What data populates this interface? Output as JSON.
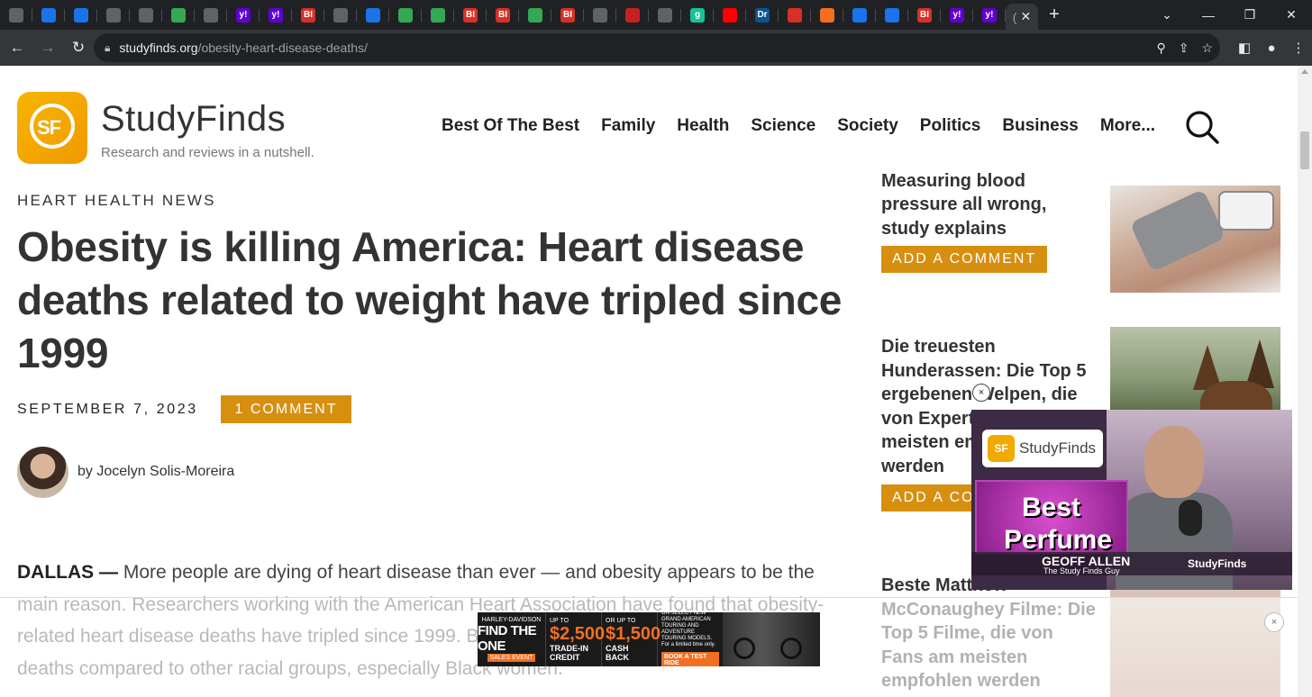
{
  "browser": {
    "tabs": [
      {
        "icon": "globe-icon",
        "label": "",
        "color": "#5f6368"
      },
      {
        "icon": "shield-icon",
        "label": "",
        "color": "#1a73e8"
      },
      {
        "icon": "shield-icon",
        "label": "",
        "color": "#1a73e8"
      },
      {
        "icon": "doc-icon",
        "label": "",
        "color": "#5f6368"
      },
      {
        "icon": "puzzle-icon",
        "label": "",
        "color": "#5f6368"
      },
      {
        "icon": "play-icon",
        "label": "",
        "color": "#34a853"
      },
      {
        "icon": "globe-icon",
        "label": "",
        "color": "#5f6368"
      },
      {
        "icon": "yahoo-icon",
        "label": "y!",
        "color": "#6001d2"
      },
      {
        "icon": "yahoo-icon",
        "label": "y!",
        "color": "#6001d2"
      },
      {
        "icon": "bi-icon",
        "label": "BI",
        "color": "#d93025"
      },
      {
        "icon": "stripe-icon",
        "label": "",
        "color": "#5f6368"
      },
      {
        "icon": "shield-icon",
        "label": "",
        "color": "#1a73e8"
      },
      {
        "icon": "play-icon",
        "label": "",
        "color": "#34a853"
      },
      {
        "icon": "play-icon",
        "label": "",
        "color": "#34a853"
      },
      {
        "icon": "bi-icon",
        "label": "BI",
        "color": "#d93025"
      },
      {
        "icon": "bi-icon",
        "label": "BI",
        "color": "#d93025"
      },
      {
        "icon": "play-icon",
        "label": "",
        "color": "#34a853"
      },
      {
        "icon": "bi-icon",
        "label": "BI",
        "color": "#d93025"
      },
      {
        "icon": "globe-icon",
        "label": "",
        "color": "#5f6368"
      },
      {
        "icon": "burst-icon",
        "label": "",
        "color": "#c5221f"
      },
      {
        "icon": "news-icon",
        "label": "",
        "color": "#5f6368"
      },
      {
        "icon": "g-icon",
        "label": "g",
        "color": "#15c39a"
      },
      {
        "icon": "youtube-icon",
        "label": "",
        "color": "#ff0000"
      },
      {
        "icon": "dr-icon",
        "label": "Dr",
        "color": "#0b5394"
      },
      {
        "icon": "arrow-icon",
        "label": "",
        "color": "#d93025"
      },
      {
        "icon": "stack-icon",
        "label": "",
        "color": "#f26f21"
      },
      {
        "icon": "cube-icon",
        "label": "",
        "color": "#1a73e8"
      },
      {
        "icon": "cube-icon",
        "label": "",
        "color": "#1a73e8"
      },
      {
        "icon": "bi-icon",
        "label": "BI",
        "color": "#d93025"
      },
      {
        "icon": "yahoo-icon",
        "label": "y!",
        "color": "#6001d2"
      },
      {
        "icon": "yahoo-icon",
        "label": "y!",
        "color": "#6001d2"
      }
    ],
    "active_tab_label": "(",
    "url_host": "studyfinds.org",
    "url_path": "/obesity-heart-disease-deaths/"
  },
  "site": {
    "logo_text": "SF",
    "name": "StudyFinds",
    "tagline": "Research and reviews in a nutshell.",
    "accent": "#d68f0f",
    "nav": [
      "Best Of The Best",
      "Family",
      "Health",
      "Science",
      "Society",
      "Politics",
      "Business",
      "More..."
    ]
  },
  "article": {
    "category": "HEART HEALTH NEWS",
    "title": "Obesity is killing America: Heart disease deaths related to weight have tripled since 1999",
    "date": "SEPTEMBER 7, 2023",
    "comments": "1 COMMENT",
    "byline": "by Jocelyn Solis-Moreira",
    "lead": "DALLAS —",
    "body": "More people are dying of heart disease than ever — and obesity appears to be the main reason. Researchers working with the American Heart Association have found that obesity-related heart disease deaths have tripled since 1999. Black Americans make up a majority of deaths compared to other racial groups, especially Black women."
  },
  "sidebar": {
    "items": [
      {
        "title_partial": "Measuring blood",
        "title": "pressure all wrong, study explains",
        "button": "ADD A COMMENT"
      },
      {
        "title": "Die treuesten Hunderassen: Die Top 5 ergebenen Welpen, die von Experten am meisten empfohlen werden",
        "button": "ADD A COMMENT"
      },
      {
        "title": "Beste Matthew McConaughey Filme: Die Top 5 Filme, die von Fans am meisten empfohlen werden"
      }
    ]
  },
  "video_ad": {
    "brand": "StudyFinds",
    "line1": "Best",
    "line2": "Perfume",
    "host_name": "GEOFF ALLEN",
    "host_title": "The Study Finds Guy",
    "footer_brand": "StudyFinds",
    "close": "×"
  },
  "banner_ad": {
    "brand_top": "HARLEY-DAVIDSON",
    "headline": "FIND THE ONE",
    "event": "SALES EVENT",
    "offer1_prefix": "UP TO",
    "offer1_amount": "$2,500",
    "offer1_label": "TRADE-IN CREDIT",
    "offer2_prefix": "OR UP TO",
    "offer2_amount": "$1,500",
    "offer2_label": "CASH BACK",
    "copy": "ON SELECT NEW GRAND AMERICAN TOURING AND ADVENTURE TOURING MODELS. For a limited time only.",
    "cta": "BOOK A TEST RIDE",
    "close": "×"
  }
}
